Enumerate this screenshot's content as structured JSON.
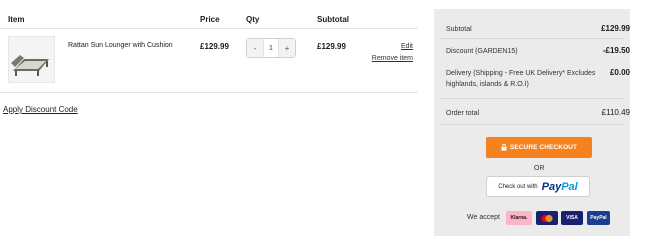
{
  "table": {
    "headers": {
      "item": "Item",
      "price": "Price",
      "qty": "Qty",
      "subtotal": "Subtotal"
    },
    "rows": [
      {
        "name": "Rattan Sun Lounger with Cushion",
        "price": "£129.99",
        "qty": "1",
        "qty_minus": "-",
        "qty_plus": "+",
        "subtotal": "£129.99",
        "edit": "Edit",
        "remove": "Remove item"
      }
    ]
  },
  "discount_link": "Apply Discount Code",
  "summary": {
    "subtotal_label": "Subtotal",
    "subtotal_value": "£129.99",
    "discount_label": "Discount (GARDEN15)",
    "discount_value": "-£19.50",
    "delivery_label": "Delivery (Shipping - Free UK Delivery* Excludes highlands, islands & R.O.I)",
    "delivery_value": "£0.00",
    "order_total_label": "Order total",
    "order_total_value": "£110.49",
    "checkout_label": "SECURE CHECKOUT",
    "or_label": "OR",
    "paypal_prefix": "Check out with",
    "paypal_pay": "Pay",
    "paypal_pal": "Pal",
    "accept_label": "We accept",
    "payment_methods": [
      {
        "name": "Klarna.",
        "bg": "#ffb3c7",
        "fg": "#17120f"
      },
      {
        "name": "mastercard",
        "bg": "#1a1f71",
        "fg": "#ffffff"
      },
      {
        "name": "VISA",
        "bg": "#1a1f71",
        "fg": "#ffffff"
      },
      {
        "name": "PayPal",
        "bg": "#1a3f8f",
        "fg": "#ffffff"
      }
    ]
  },
  "colors": {
    "checkout_orange": "#f5811f",
    "panel_grey": "#ebebeb"
  }
}
